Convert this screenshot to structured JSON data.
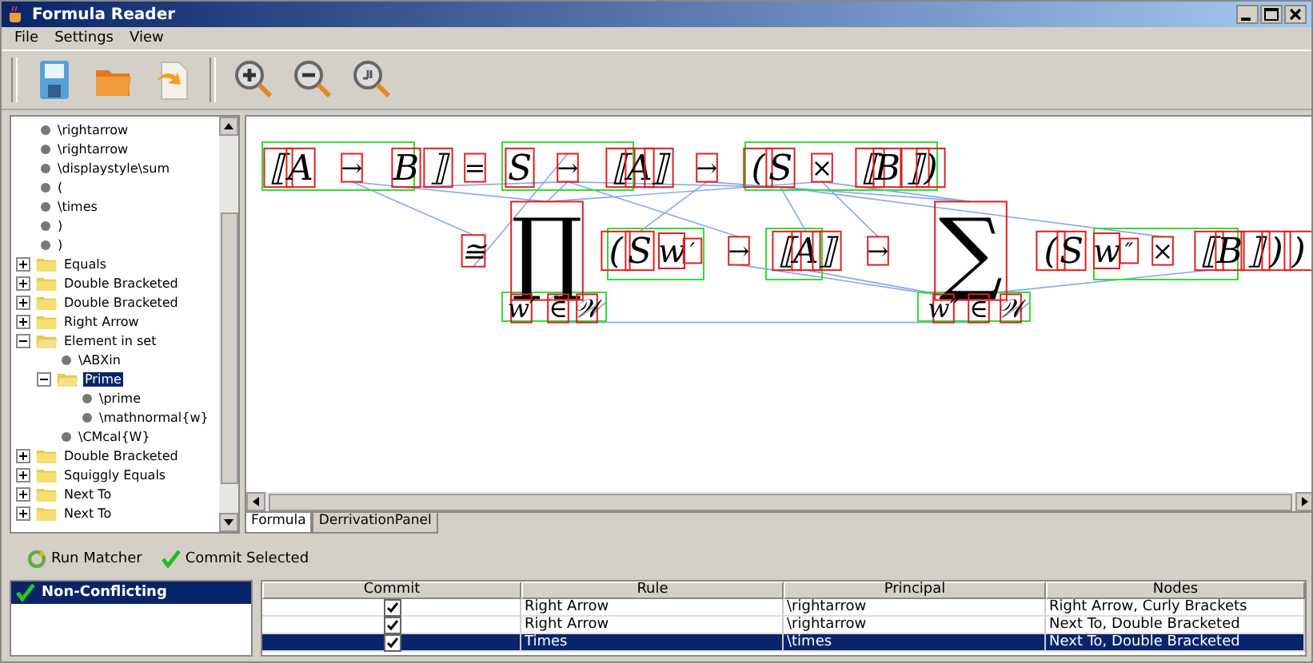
{
  "window": {
    "title": "Formula Reader"
  },
  "menu": [
    "File",
    "Settings",
    "View"
  ],
  "tree": [
    {
      "kind": "leaf",
      "label": "\\rightarrow"
    },
    {
      "kind": "leaf",
      "label": "\\rightarrow"
    },
    {
      "kind": "leaf",
      "label": "\\displaystyle\\sum"
    },
    {
      "kind": "leaf",
      "label": "("
    },
    {
      "kind": "leaf",
      "label": "\\times"
    },
    {
      "kind": "leaf",
      "label": ")"
    },
    {
      "kind": "leaf",
      "label": ")"
    },
    {
      "kind": "folder",
      "label": "Equals",
      "expanded": false,
      "selected": false
    },
    {
      "kind": "folder",
      "label": "Double Bracketed",
      "expanded": false,
      "selected": false
    },
    {
      "kind": "folder",
      "label": "Double Bracketed",
      "expanded": false,
      "selected": false
    },
    {
      "kind": "folder",
      "label": "Right Arrow",
      "expanded": false,
      "selected": false
    },
    {
      "kind": "folder",
      "label": "Element in set",
      "expanded": true,
      "selected": false,
      "children": [
        {
          "kind": "leaf",
          "label": "\\ABXin"
        },
        {
          "kind": "folder",
          "label": "Prime",
          "expanded": true,
          "selected": true,
          "children": [
            {
              "kind": "leaf",
              "label": "\\prime"
            },
            {
              "kind": "leaf",
              "label": "\\mathnormal{w}"
            }
          ]
        },
        {
          "kind": "leaf",
          "label": "\\CMcal{W}"
        }
      ]
    },
    {
      "kind": "folder",
      "label": "Double Bracketed",
      "expanded": false,
      "selected": false
    },
    {
      "kind": "folder",
      "label": "Squiggly Equals",
      "expanded": false,
      "selected": false
    },
    {
      "kind": "folder",
      "label": "Next To",
      "expanded": false,
      "selected": false
    },
    {
      "kind": "folder",
      "label": "Next To",
      "expanded": false,
      "selected": false
    }
  ],
  "formula": {
    "symbols": [
      "⟦",
      "A",
      "→",
      "B",
      "⟧",
      "=",
      "S",
      "→",
      "⟦",
      "A",
      "⟧",
      "→",
      "(",
      "S",
      "×",
      "⟦",
      "B",
      "⟧",
      ")",
      "≅",
      "∏",
      "(",
      "S",
      "w",
      "′",
      "→",
      "⟦",
      "A",
      "⟧",
      "→",
      "∑",
      "(",
      "S",
      "w",
      "″",
      "×",
      "⟦",
      "B",
      "⟧",
      ")",
      ")",
      "w′",
      "∈",
      "𝒲",
      "w″",
      "∈",
      "𝒲"
    ]
  },
  "tabs": [
    {
      "label": "Formula",
      "selected": true
    },
    {
      "label": "DerrivationPanel",
      "selected": false
    }
  ],
  "actions": [
    "Run Matcher",
    "Commit Selected"
  ],
  "groups": [
    {
      "label": "Non-Conflicting",
      "selected": true
    }
  ],
  "table": {
    "columns": [
      "Commit",
      "Rule",
      "Principal",
      "Nodes"
    ],
    "rows": [
      {
        "checked": true,
        "rule": "Right Arrow",
        "principal": "\\rightarrow",
        "nodes": "Right Arrow, Curly Brackets",
        "selected": false
      },
      {
        "checked": true,
        "rule": "Right Arrow",
        "principal": "\\rightarrow",
        "nodes": "Next To, Double Bracketed",
        "selected": false
      },
      {
        "checked": true,
        "rule": "Times",
        "principal": "\\times",
        "nodes": "Next To, Double Bracketed",
        "selected": true
      }
    ]
  }
}
